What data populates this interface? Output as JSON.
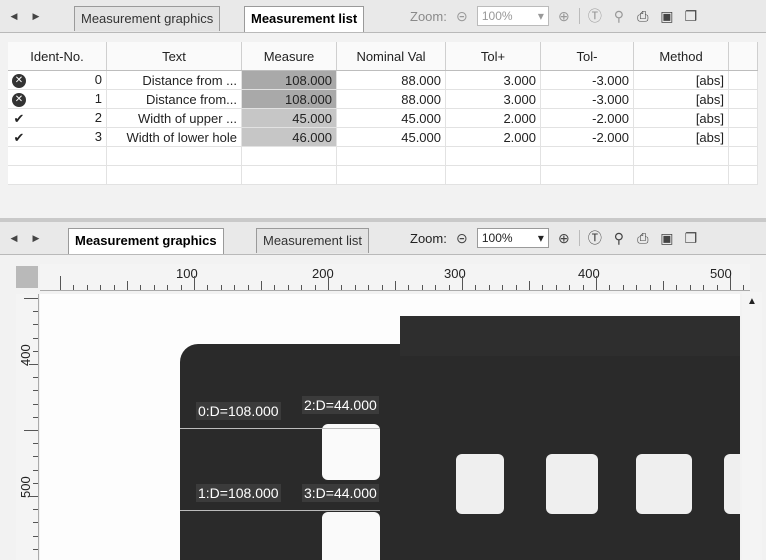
{
  "top_panel": {
    "tabs": [
      {
        "label": "Measurement graphics",
        "active": false
      },
      {
        "label": "Measurement list",
        "active": true
      }
    ],
    "zoom_label": "Zoom:",
    "zoom_value": "100%",
    "table": {
      "headers": [
        "Ident-No.",
        "Text",
        "Measure",
        "Nominal Val",
        "Tol+",
        "Tol-",
        "Method"
      ],
      "rows": [
        {
          "status": "error",
          "ident": "0",
          "text": "Distance from ...",
          "measure": "108.000",
          "nominal": "88.000",
          "tol_plus": "3.000",
          "tol_minus": "-3.000",
          "method": "[abs]"
        },
        {
          "status": "error",
          "ident": "1",
          "text": "Distance from...",
          "measure": "108.000",
          "nominal": "88.000",
          "tol_plus": "3.000",
          "tol_minus": "-3.000",
          "method": "[abs]"
        },
        {
          "status": "ok",
          "ident": "2",
          "text": "Width of upper ...",
          "measure": "45.000",
          "nominal": "45.000",
          "tol_plus": "2.000",
          "tol_minus": "-2.000",
          "method": "[abs]"
        },
        {
          "status": "ok",
          "ident": "3",
          "text": "Width of lower hole",
          "measure": "46.000",
          "nominal": "45.000",
          "tol_plus": "2.000",
          "tol_minus": "-2.000",
          "method": "[abs]"
        }
      ]
    }
  },
  "bottom_panel": {
    "tabs": [
      {
        "label": "Measurement graphics",
        "active": true
      },
      {
        "label": "Measurement list",
        "active": false
      }
    ],
    "zoom_label": "Zoom:",
    "zoom_value": "100%",
    "ruler_h_labels": [
      "100",
      "200",
      "300",
      "400",
      "500"
    ],
    "ruler_v_labels": [
      "400",
      "500"
    ],
    "annotations": [
      "0:D=108.000",
      "2:D=44.000",
      "1:D=108.000",
      "3:D=44.000"
    ]
  },
  "icons": {
    "nav_prev": "left-arrow-icon",
    "nav_next": "right-arrow-icon",
    "zoom_out": "minus-circle-icon",
    "zoom_in": "plus-circle-icon",
    "zoom_fit": "fit-icon",
    "zoom_search": "magnifier-icon",
    "print": "printer-icon",
    "save": "floppy-icon",
    "copy": "copy-icon"
  },
  "colors": {
    "error_status": "#333333",
    "measure_fail": "#a9a9a9",
    "measure_ok": "#c6c6c6"
  }
}
